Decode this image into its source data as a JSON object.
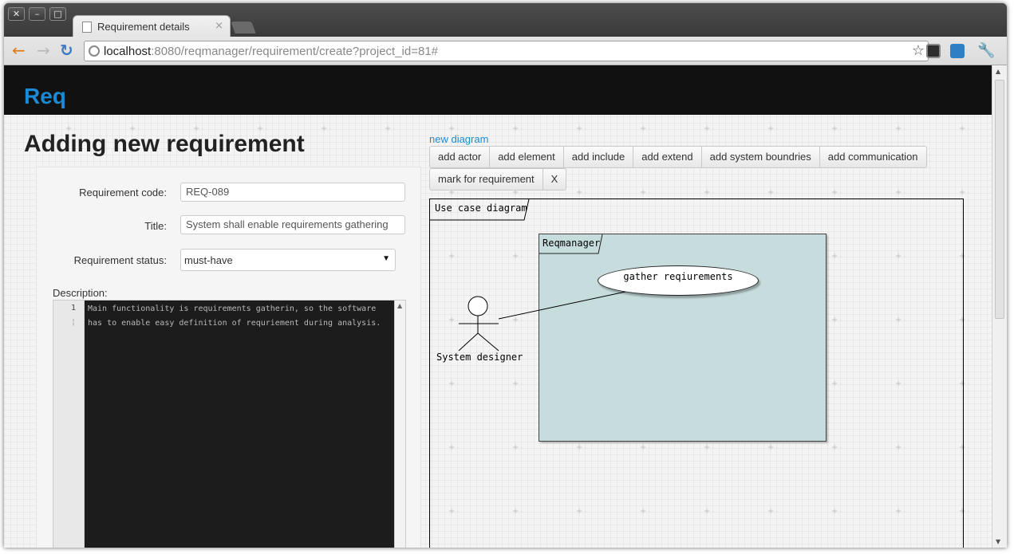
{
  "window": {
    "tab_title": "Requirement details",
    "tab_close": "×",
    "wm_close": "✕",
    "wm_minimize": "–",
    "wm_maximize": "□"
  },
  "browser": {
    "url_host": "localhost",
    "url_rest": ":8080/reqmanager/requirement/create?project_id=81#",
    "back_icon": "back-arrow-icon",
    "forward_icon": "forward-arrow-icon",
    "reload_icon": "reload-icon"
  },
  "app": {
    "brand": "Req"
  },
  "page": {
    "title": "Adding new requirement"
  },
  "form": {
    "code_label": "Requirement code:",
    "code_value": "REQ-089",
    "title_label": "Title:",
    "title_value": "System shall enable requirements gathering",
    "status_label": "Requirement status:",
    "status_value": "must-have",
    "description_label": "Description:",
    "description_lines": [
      "Main functionality is requirements gatherin, so the software",
      "has to enable easy definition of requriement during analysis."
    ],
    "line_number": "1"
  },
  "diagram": {
    "new_link": "new diagram",
    "toolbar": [
      "add actor",
      "add element",
      "add include",
      "add extend",
      "add system boundries",
      "add communication"
    ],
    "toolbar2": [
      "mark for requirement",
      "X"
    ],
    "frame_label": "Use case diagram",
    "system_label": "Reqmanager",
    "usecase_label": "gather reqiurements",
    "actor_label": "System designer"
  },
  "colors": {
    "brand": "#1a8ad4",
    "navbar": "#111111",
    "system_fill": "#c7dcdd",
    "editor_bg": "#1c1c1c"
  }
}
